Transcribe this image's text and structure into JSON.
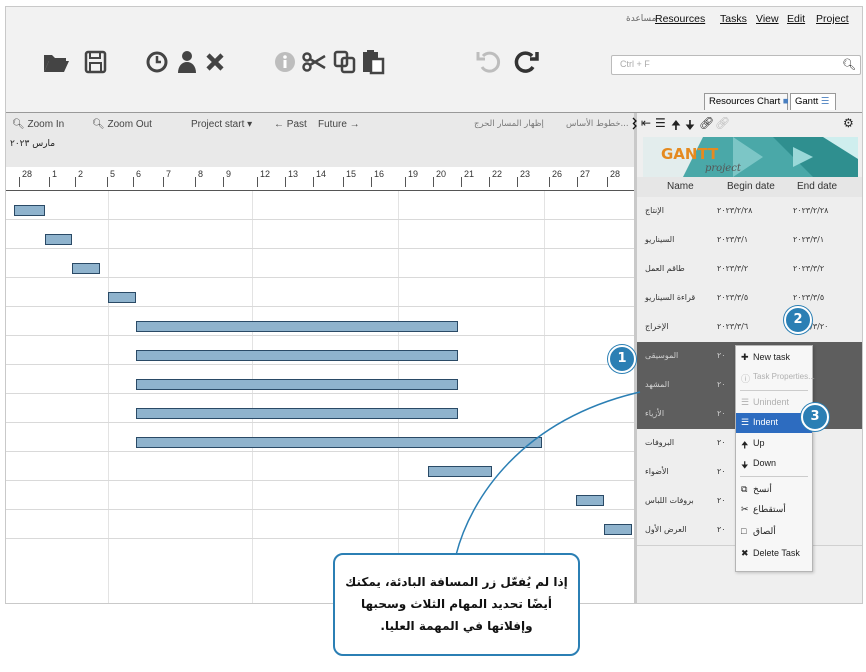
{
  "menu": {
    "help": "مساعدة",
    "resources": "Resources",
    "tasks": "Tasks",
    "view": "View",
    "edit": "Edit",
    "project": "Project"
  },
  "toolbar": {
    "icons": [
      "folder-open-icon",
      "save-icon",
      "clock-icon",
      "user-icon",
      "delete-icon",
      "info-icon",
      "cut-icon",
      "copy-icon",
      "paste-icon",
      "undo-icon",
      "redo-icon"
    ]
  },
  "search": {
    "placeholder": "Ctrl + F"
  },
  "tabs": {
    "resources_chart": "Resources Chart",
    "gantt": "Gantt"
  },
  "chart_controls": {
    "zoom_in": "Zoom In",
    "zoom_out": "Zoom Out",
    "project_start": "Project start",
    "past": "← Past",
    "future": "Future →",
    "baseline_ar": "خطوط الأساس...",
    "critical_path_ar": "إظهار المسار الحرج",
    "month": "مارس ٢٠٢٣"
  },
  "timeline_days": [
    "28",
    "1",
    "2",
    "5",
    "6",
    "7",
    "8",
    "9",
    "12",
    "13",
    "14",
    "15",
    "16",
    "19",
    "20",
    "21",
    "22",
    "23",
    "26",
    "27",
    "28"
  ],
  "task_grid": {
    "col_name": "Name",
    "col_begin": "Begin date",
    "col_end": "End date"
  },
  "tasks": [
    {
      "name": "الإنتاج",
      "begin": "٢٠٢٣/٢/٢٨",
      "end": "٢٠٢٣/٢/٢٨",
      "selected": false
    },
    {
      "name": "السيناريو",
      "begin": "٢٠٢٣/٣/١",
      "end": "٢٠٢٣/٣/١",
      "selected": false
    },
    {
      "name": "طاقم العمل",
      "begin": "٢٠٢٣/٣/٢",
      "end": "٢٠٢٣/٣/٢",
      "selected": false
    },
    {
      "name": "قراءة السيناريو",
      "begin": "٢٠٢٣/٣/٥",
      "end": "٢٠٢٣/٣/٥",
      "selected": false
    },
    {
      "name": "الإخراج",
      "begin": "٢٠٢٣/٣/٦",
      "end": "٢٠٢٣/٣/٢٠",
      "selected": false
    },
    {
      "name": "الموسيقى",
      "begin": "٢٠",
      "end": "",
      "selected": true
    },
    {
      "name": "المشهد",
      "begin": "٢٠",
      "end": "",
      "selected": true
    },
    {
      "name": "الأزياء",
      "begin": "٢٠",
      "end": "",
      "selected": true
    },
    {
      "name": "البروفات",
      "begin": "٢٠",
      "end": "",
      "selected": false
    },
    {
      "name": "الأضواء",
      "begin": "٢٠",
      "end": "",
      "selected": false
    },
    {
      "name": "بروفات اللباس",
      "begin": "٢٠",
      "end": "",
      "selected": false
    },
    {
      "name": "العرض الأول",
      "begin": "٢٠",
      "end": "",
      "selected": false
    }
  ],
  "context_menu": {
    "new_task": "New task",
    "task_properties": "Task Properties...",
    "unindent": "Unindent",
    "indent": "Indent",
    "up": "Up",
    "down": "Down",
    "copy": "أنسخ",
    "cut": "أستقطاع",
    "paste": "ألصاق",
    "delete": "Delete Task"
  },
  "badges": {
    "one": "1",
    "two": "2",
    "three": "3"
  },
  "callout": {
    "text": "إذا لم يُفعّل زر المسافة البادئة، يمكنك أيضًا تحديد المهام الثلاث وسحبها وإفلاتها في المهمة العليا."
  },
  "colors": {
    "accent": "#2b7fb4",
    "bar_fill": "#8fb3cd",
    "bar_border": "#2a4a66",
    "selected_row": "#5e5e5e",
    "highlight": "#2d6cc0"
  }
}
